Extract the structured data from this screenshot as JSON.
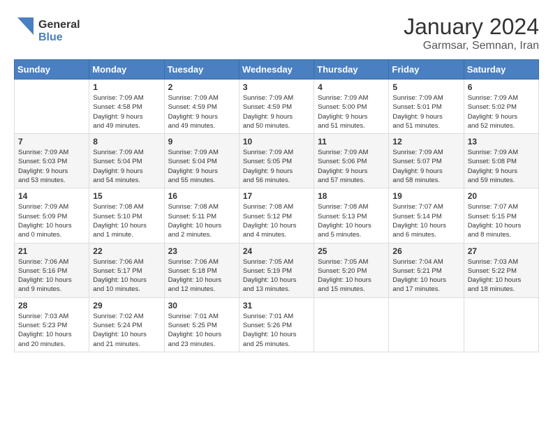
{
  "header": {
    "logo_general": "General",
    "logo_blue": "Blue",
    "month_year": "January 2024",
    "location": "Garmsar, Semnan, Iran"
  },
  "weekdays": [
    "Sunday",
    "Monday",
    "Tuesday",
    "Wednesday",
    "Thursday",
    "Friday",
    "Saturday"
  ],
  "weeks": [
    [
      {
        "day": "",
        "info": ""
      },
      {
        "day": "1",
        "info": "Sunrise: 7:09 AM\nSunset: 4:58 PM\nDaylight: 9 hours\nand 49 minutes."
      },
      {
        "day": "2",
        "info": "Sunrise: 7:09 AM\nSunset: 4:59 PM\nDaylight: 9 hours\nand 49 minutes."
      },
      {
        "day": "3",
        "info": "Sunrise: 7:09 AM\nSunset: 4:59 PM\nDaylight: 9 hours\nand 50 minutes."
      },
      {
        "day": "4",
        "info": "Sunrise: 7:09 AM\nSunset: 5:00 PM\nDaylight: 9 hours\nand 51 minutes."
      },
      {
        "day": "5",
        "info": "Sunrise: 7:09 AM\nSunset: 5:01 PM\nDaylight: 9 hours\nand 51 minutes."
      },
      {
        "day": "6",
        "info": "Sunrise: 7:09 AM\nSunset: 5:02 PM\nDaylight: 9 hours\nand 52 minutes."
      }
    ],
    [
      {
        "day": "7",
        "info": "Sunrise: 7:09 AM\nSunset: 5:03 PM\nDaylight: 9 hours\nand 53 minutes."
      },
      {
        "day": "8",
        "info": "Sunrise: 7:09 AM\nSunset: 5:04 PM\nDaylight: 9 hours\nand 54 minutes."
      },
      {
        "day": "9",
        "info": "Sunrise: 7:09 AM\nSunset: 5:04 PM\nDaylight: 9 hours\nand 55 minutes."
      },
      {
        "day": "10",
        "info": "Sunrise: 7:09 AM\nSunset: 5:05 PM\nDaylight: 9 hours\nand 56 minutes."
      },
      {
        "day": "11",
        "info": "Sunrise: 7:09 AM\nSunset: 5:06 PM\nDaylight: 9 hours\nand 57 minutes."
      },
      {
        "day": "12",
        "info": "Sunrise: 7:09 AM\nSunset: 5:07 PM\nDaylight: 9 hours\nand 58 minutes."
      },
      {
        "day": "13",
        "info": "Sunrise: 7:09 AM\nSunset: 5:08 PM\nDaylight: 9 hours\nand 59 minutes."
      }
    ],
    [
      {
        "day": "14",
        "info": "Sunrise: 7:09 AM\nSunset: 5:09 PM\nDaylight: 10 hours\nand 0 minutes."
      },
      {
        "day": "15",
        "info": "Sunrise: 7:08 AM\nSunset: 5:10 PM\nDaylight: 10 hours\nand 1 minute."
      },
      {
        "day": "16",
        "info": "Sunrise: 7:08 AM\nSunset: 5:11 PM\nDaylight: 10 hours\nand 2 minutes."
      },
      {
        "day": "17",
        "info": "Sunrise: 7:08 AM\nSunset: 5:12 PM\nDaylight: 10 hours\nand 4 minutes."
      },
      {
        "day": "18",
        "info": "Sunrise: 7:08 AM\nSunset: 5:13 PM\nDaylight: 10 hours\nand 5 minutes."
      },
      {
        "day": "19",
        "info": "Sunrise: 7:07 AM\nSunset: 5:14 PM\nDaylight: 10 hours\nand 6 minutes."
      },
      {
        "day": "20",
        "info": "Sunrise: 7:07 AM\nSunset: 5:15 PM\nDaylight: 10 hours\nand 8 minutes."
      }
    ],
    [
      {
        "day": "21",
        "info": "Sunrise: 7:06 AM\nSunset: 5:16 PM\nDaylight: 10 hours\nand 9 minutes."
      },
      {
        "day": "22",
        "info": "Sunrise: 7:06 AM\nSunset: 5:17 PM\nDaylight: 10 hours\nand 10 minutes."
      },
      {
        "day": "23",
        "info": "Sunrise: 7:06 AM\nSunset: 5:18 PM\nDaylight: 10 hours\nand 12 minutes."
      },
      {
        "day": "24",
        "info": "Sunrise: 7:05 AM\nSunset: 5:19 PM\nDaylight: 10 hours\nand 13 minutes."
      },
      {
        "day": "25",
        "info": "Sunrise: 7:05 AM\nSunset: 5:20 PM\nDaylight: 10 hours\nand 15 minutes."
      },
      {
        "day": "26",
        "info": "Sunrise: 7:04 AM\nSunset: 5:21 PM\nDaylight: 10 hours\nand 17 minutes."
      },
      {
        "day": "27",
        "info": "Sunrise: 7:03 AM\nSunset: 5:22 PM\nDaylight: 10 hours\nand 18 minutes."
      }
    ],
    [
      {
        "day": "28",
        "info": "Sunrise: 7:03 AM\nSunset: 5:23 PM\nDaylight: 10 hours\nand 20 minutes."
      },
      {
        "day": "29",
        "info": "Sunrise: 7:02 AM\nSunset: 5:24 PM\nDaylight: 10 hours\nand 21 minutes."
      },
      {
        "day": "30",
        "info": "Sunrise: 7:01 AM\nSunset: 5:25 PM\nDaylight: 10 hours\nand 23 minutes."
      },
      {
        "day": "31",
        "info": "Sunrise: 7:01 AM\nSunset: 5:26 PM\nDaylight: 10 hours\nand 25 minutes."
      },
      {
        "day": "",
        "info": ""
      },
      {
        "day": "",
        "info": ""
      },
      {
        "day": "",
        "info": ""
      }
    ]
  ]
}
